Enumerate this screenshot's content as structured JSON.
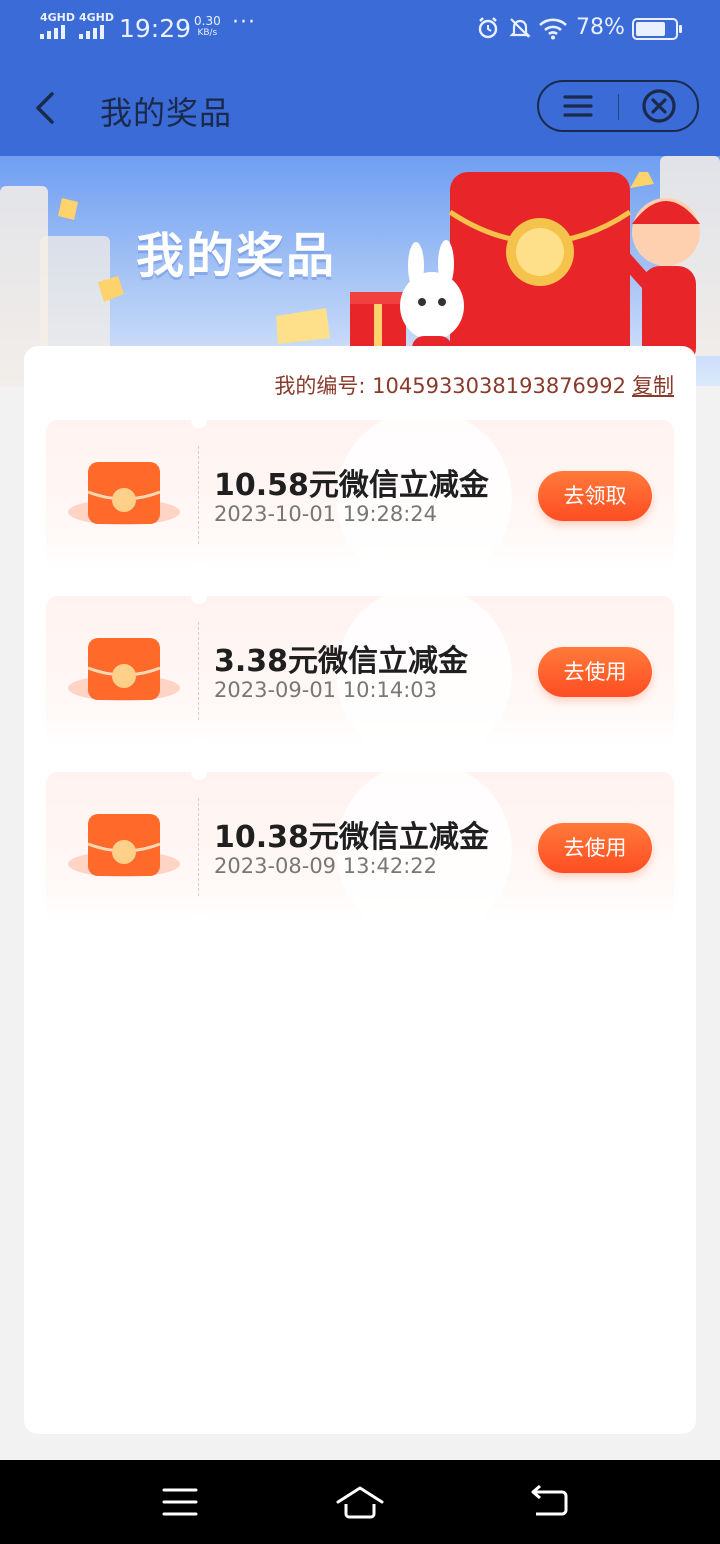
{
  "status_bar": {
    "network_1": "4GHD",
    "network_2": "4GHD",
    "time": "19:29",
    "speed_value": "0.30",
    "speed_unit": "KB/s",
    "more": "···",
    "battery": "78%",
    "battery_level": 0.78
  },
  "header": {
    "title": "我的奖品"
  },
  "banner": {
    "title": "我的奖品"
  },
  "member": {
    "label": "我的编号: 1045933038193876992",
    "copy_label": "复制"
  },
  "prizes": [
    {
      "name": "10.58元微信立减金",
      "date": "2023-10-01 19:28:24",
      "action": "去领取"
    },
    {
      "name": "3.38元微信立减金",
      "date": "2023-09-01 10:14:03",
      "action": "去使用"
    },
    {
      "name": "10.38元微信立减金",
      "date": "2023-08-09 13:42:22",
      "action": "去使用"
    }
  ],
  "colors": {
    "header_bg": "#3a6bd6",
    "action_button": "#ff5a2a",
    "member_text": "#8a3a2a"
  },
  "icons": {
    "back": "chevron-left-icon",
    "menu": "menu-icon",
    "close": "close-circle-icon",
    "nav_menu": "menu-lines-icon",
    "nav_home": "home-icon",
    "nav_back": "return-icon"
  }
}
